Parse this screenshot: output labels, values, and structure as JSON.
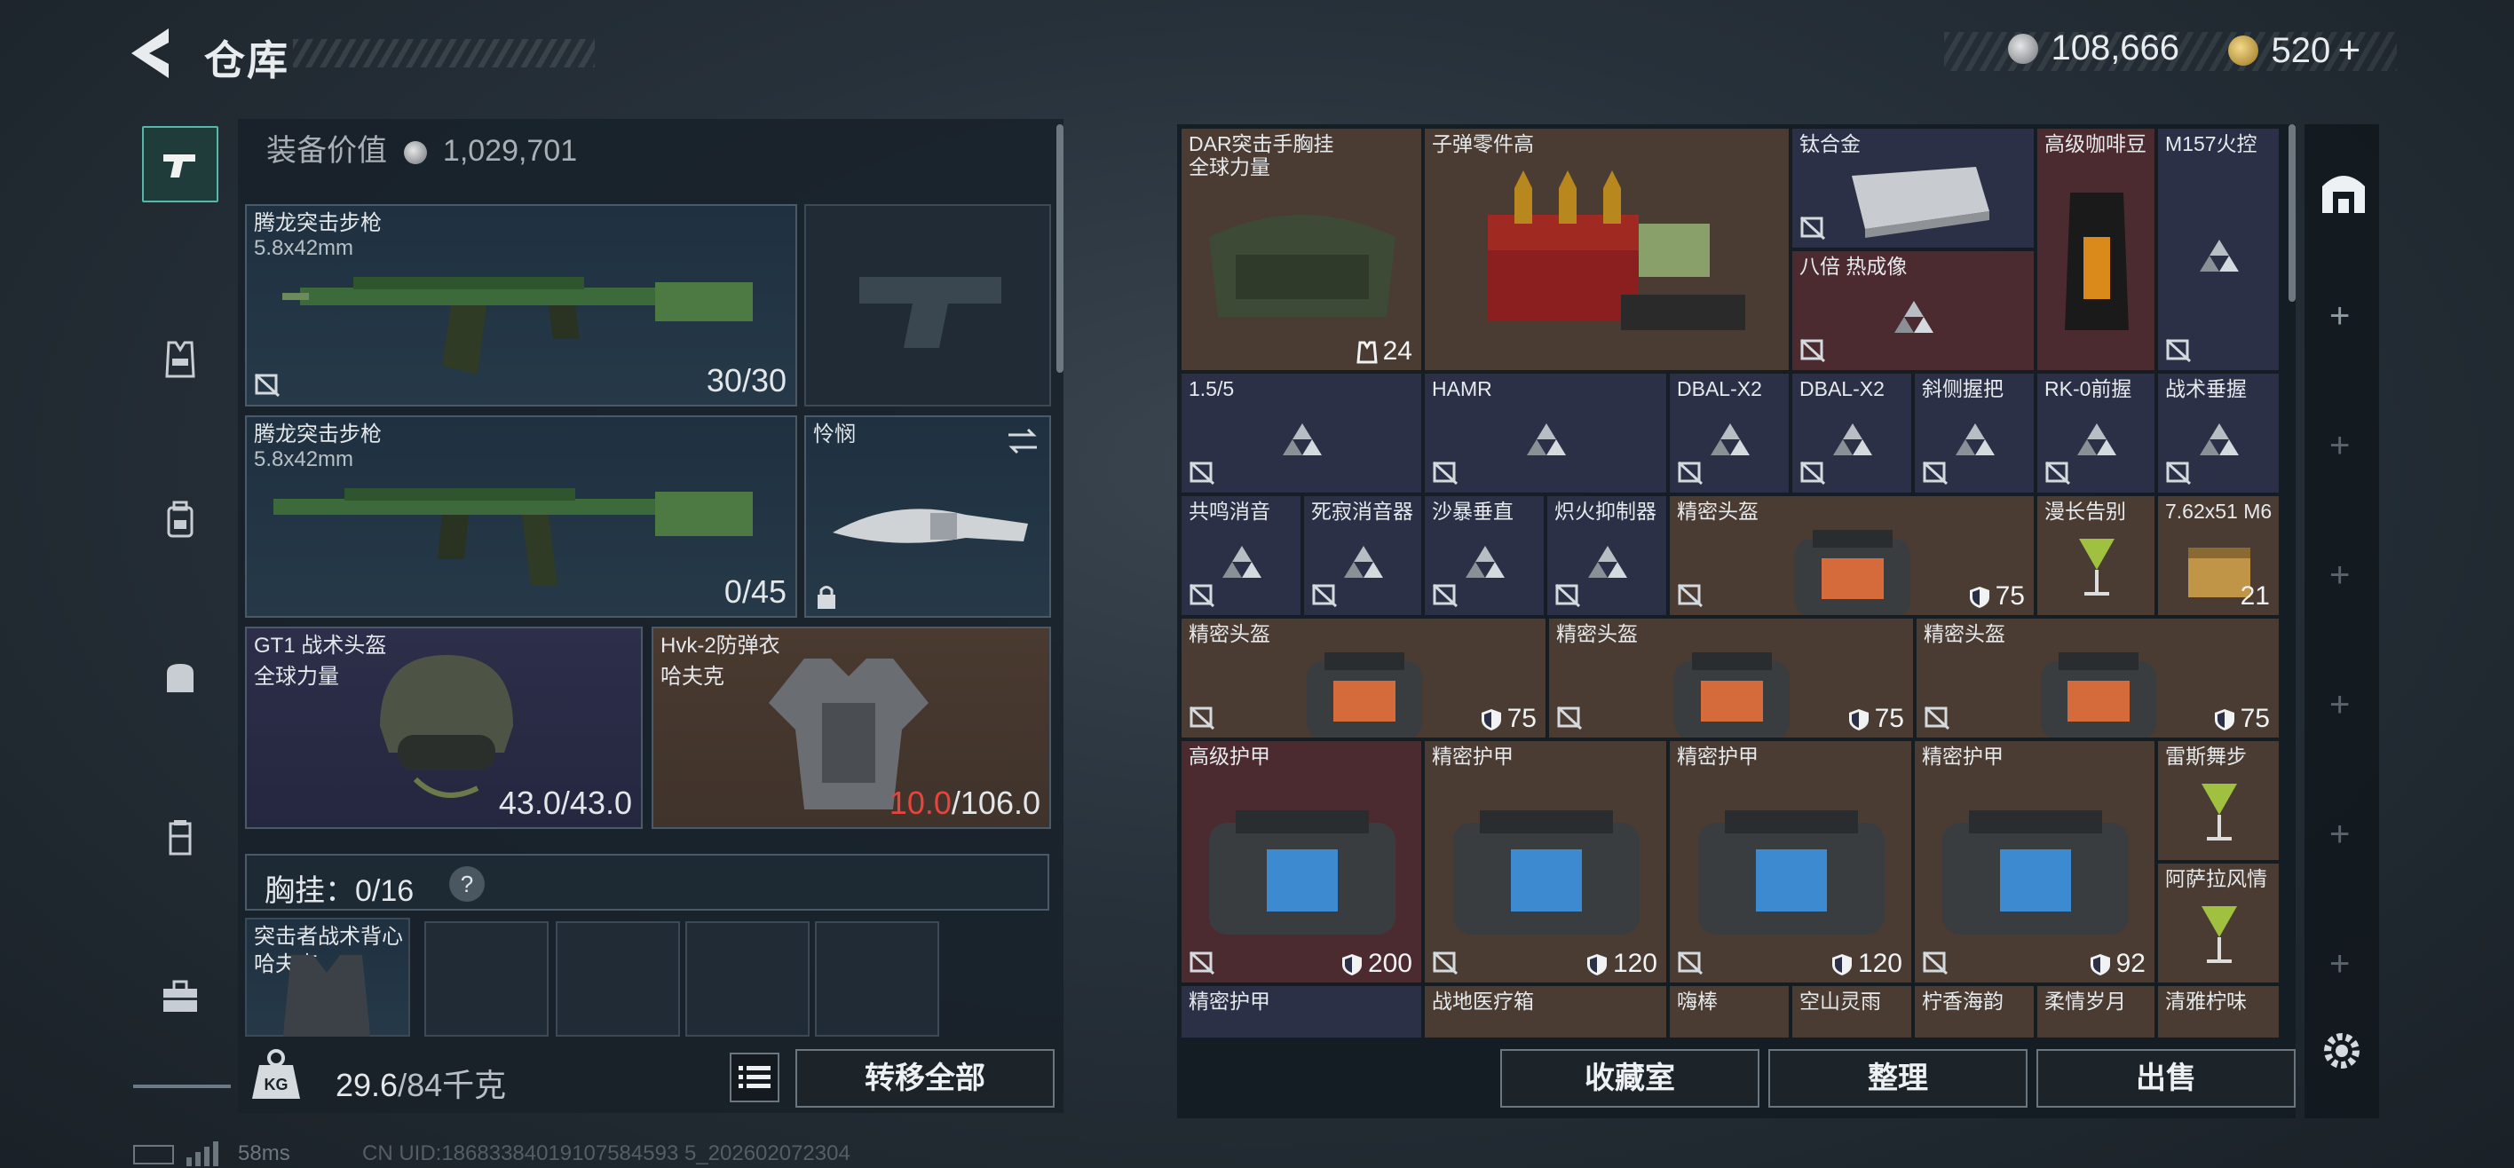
{
  "header": {
    "title": "仓库"
  },
  "currency": {
    "silver": "108,666",
    "gold": "520",
    "gold_plus": "+"
  },
  "loadout": {
    "equip_value_label": "装备价值",
    "equip_value": "1,029,701",
    "primary_weapon": {
      "name": "腾龙突击步枪",
      "ammo": "5.8x42mm",
      "count": "30/30"
    },
    "secondary_weapon": {
      "name": "腾龙突击步枪",
      "ammo": "5.8x42mm",
      "count": "0/45"
    },
    "melee": {
      "name": "怜悯"
    },
    "helmet": {
      "name": "GT1 战术头盔",
      "brand": "全球力量",
      "durability_current": "43.0",
      "durability_max": "/43.0"
    },
    "armor": {
      "name": "Hvk-2防弹衣",
      "brand": "哈夫克",
      "durability_current": "10.0",
      "durability_max": "/106.0"
    },
    "chest_rig": {
      "label": "胸挂",
      "capacity": "0/16",
      "help": "?"
    },
    "backpack": {
      "name": "突击者战术背心",
      "brand": "哈夫克"
    },
    "weight": {
      "value": "29.6",
      "max_unit": "/84千克"
    },
    "transfer_all": "转移全部"
  },
  "inventory": {
    "cells": [
      {
        "name": "DAR突击手胸挂",
        "sub": "全球力量",
        "count": "24"
      },
      {
        "name": "子弹零件高"
      },
      {
        "name": "钛合金"
      },
      {
        "name": "高级咖啡豆"
      },
      {
        "name": "M157火控"
      },
      {
        "name": "八倍 热成像"
      },
      {
        "name": "1.5/5"
      },
      {
        "name": "HAMR"
      },
      {
        "name": "DBAL-X2"
      },
      {
        "name": "DBAL-X2"
      },
      {
        "name": "斜侧握把"
      },
      {
        "name": "RK-0前握"
      },
      {
        "name": "战术垂握"
      },
      {
        "name": "共鸣消音"
      },
      {
        "name": "死寂消音器"
      },
      {
        "name": "沙暴垂直"
      },
      {
        "name": "炽火抑制器"
      },
      {
        "name": "精密头盔",
        "count": "75"
      },
      {
        "name": "漫长告别"
      },
      {
        "name": "7.62x51 M6",
        "count": "21"
      },
      {
        "name": "精密头盔",
        "count": "75"
      },
      {
        "name": "精密头盔",
        "count": "75"
      },
      {
        "name": "精密头盔",
        "count": "75"
      },
      {
        "name": "高级护甲",
        "count": "200"
      },
      {
        "name": "精密护甲",
        "count": "120"
      },
      {
        "name": "精密护甲",
        "count": "120"
      },
      {
        "name": "精密护甲",
        "count": "92"
      },
      {
        "name": "雷斯舞步"
      },
      {
        "name": "阿萨拉风情"
      },
      {
        "name": "精密护甲"
      },
      {
        "name": "战地医疗箱"
      },
      {
        "name": "嗨棒"
      },
      {
        "name": "空山灵雨"
      },
      {
        "name": "柠香海韵"
      },
      {
        "name": "柔情岁月"
      },
      {
        "name": "清雅柠味"
      }
    ]
  },
  "actions": {
    "collection": "收藏室",
    "organize": "整理",
    "sell": "出售"
  },
  "status": {
    "ping": "58ms",
    "uid": "CN UID:18683384019107584593 5_202602072304"
  }
}
